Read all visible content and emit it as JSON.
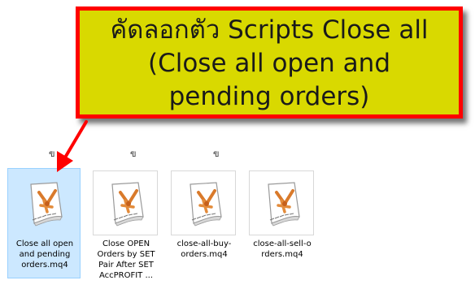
{
  "annotation": {
    "lines": [
      "คัดลอกตัว Scripts Close all",
      "(Close all open and",
      "pending orders)"
    ],
    "colors": {
      "background": "#d9d900",
      "border": "#ff0000",
      "arrow": "#ff0000"
    }
  },
  "stub_labels": [
    "ข้",
    "ข้",
    "ข้"
  ],
  "files": [
    {
      "label_lines": [
        "Close all open",
        "and pending",
        "orders.mq4"
      ],
      "selected": true,
      "icon": "mq4-script-icon"
    },
    {
      "label_lines": [
        "Close OPEN",
        "Orders by SET",
        "Pair After SET",
        "AccPROFIT ..."
      ],
      "selected": false,
      "icon": "mq4-script-icon"
    },
    {
      "label_lines": [
        "close-all-buy-",
        "orders.mq4"
      ],
      "selected": false,
      "icon": "mq4-script-icon"
    },
    {
      "label_lines": [
        "close-all-sell-o",
        "rders.mq4"
      ],
      "selected": false,
      "icon": "mq4-script-icon"
    }
  ]
}
